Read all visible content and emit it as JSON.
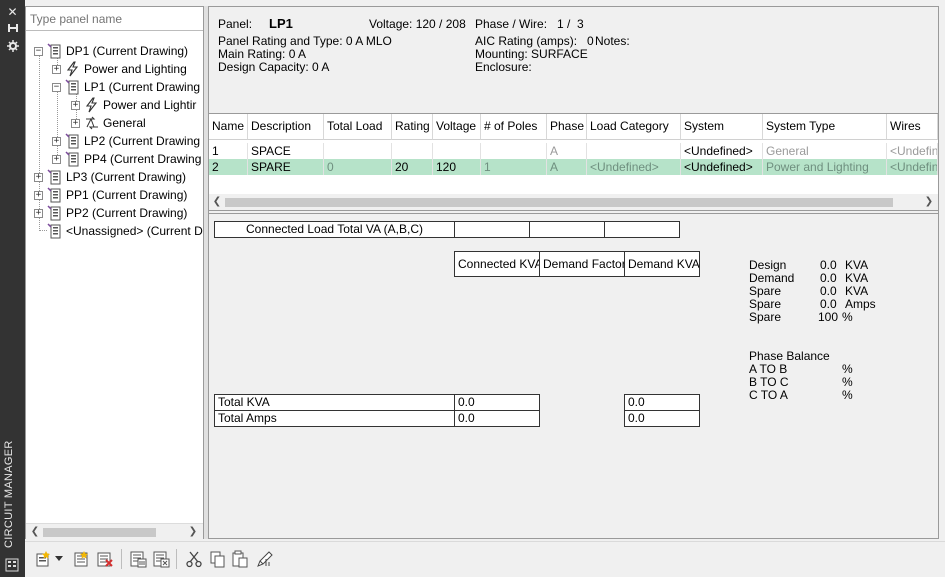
{
  "rail": {
    "title": "CIRCUIT MANAGER",
    "icons": [
      "close-icon",
      "auto-hide-icon",
      "properties-icon"
    ]
  },
  "tree": {
    "search_placeholder": "Type panel name",
    "nodes": [
      {
        "label": "DP1 (Current Drawing)",
        "icon": "panel-icon",
        "expander": "−"
      },
      {
        "label": "Power and Lighting",
        "icon": "lightning-icon",
        "expander": "+"
      },
      {
        "label": "LP1 (Current Drawing",
        "icon": "panel-icon",
        "expander": "−"
      },
      {
        "label": "Power and Lightir",
        "icon": "lightning-icon",
        "expander": "+"
      },
      {
        "label": "General",
        "icon": "circuit-icon",
        "expander": "+"
      },
      {
        "label": "LP2 (Current Drawing",
        "icon": "panel-icon",
        "expander": "+"
      },
      {
        "label": "PP4 (Current Drawing",
        "icon": "panel-icon",
        "expander": "+"
      },
      {
        "label": "LP3 (Current Drawing)",
        "icon": "panel-icon",
        "expander": "+"
      },
      {
        "label": "PP1 (Current Drawing)",
        "icon": "panel-icon",
        "expander": "+"
      },
      {
        "label": "PP2 (Current Drawing)",
        "icon": "panel-icon",
        "expander": "+"
      },
      {
        "label": "<Unassigned> (Current D",
        "icon": "panel-icon",
        "expander": ""
      }
    ]
  },
  "info": {
    "panel_label": "Panel:",
    "panel_value": "LP1",
    "voltage": "Voltage: 120 / 208",
    "phase_wire": "Phase / Wire:   1 /  3",
    "rating_type": "Panel Rating and Type: 0 A MLO",
    "aic": "AIC Rating (amps):   0",
    "notes": "Notes:",
    "main_rating": "Main Rating: 0 A",
    "mounting": "Mounting: SURFACE",
    "design_capacity": "Design Capacity: 0 A",
    "enclosure": "Enclosure:"
  },
  "grid": {
    "columns": [
      "Name",
      "Description",
      "Total Load",
      "Rating",
      "Voltage",
      "# of Poles",
      "Phase",
      "Load Category",
      "System",
      "System Type",
      "Wires"
    ],
    "rows": [
      {
        "cells": [
          "1",
          "SPACE",
          "",
          "",
          "",
          "",
          "A",
          "",
          "<Undefined>",
          "General",
          "<Undefin"
        ],
        "selected": false
      },
      {
        "cells": [
          "2",
          "SPARE",
          "0",
          "20",
          "120",
          "1",
          "A",
          "<Undefined>",
          "<Undefined>",
          "Power and Lighting",
          "<Undefin"
        ],
        "selected": true
      }
    ],
    "selected_color": "#b6e3c9"
  },
  "summary": {
    "connected_load_label": "Connected Load Total VA (A,B,C)",
    "headers": {
      "connected_kva": "Connected KVA",
      "demand_factor": "Demand Factor",
      "demand_kva": "Demand KVA"
    },
    "totals": [
      {
        "label": "Total KVA",
        "connected": "0.0",
        "demand": "0.0"
      },
      {
        "label": "Total Amps",
        "connected": "0.0",
        "demand": "0.0"
      }
    ],
    "stats": [
      {
        "label": "Design",
        "value": "0.0",
        "unit": "KVA"
      },
      {
        "label": "Demand",
        "value": "0.0",
        "unit": "KVA"
      },
      {
        "label": "Spare",
        "value": "0.0",
        "unit": "KVA"
      },
      {
        "label": "Spare",
        "value": "0.0",
        "unit": "Amps"
      },
      {
        "label": "Spare",
        "value": "100",
        "unit": "%"
      }
    ],
    "phase_balance": {
      "title": "Phase Balance",
      "rows": [
        {
          "label": "A TO B",
          "unit": "%"
        },
        {
          "label": "B TO C",
          "unit": "%"
        },
        {
          "label": "C TO A",
          "unit": "%"
        }
      ]
    }
  },
  "toolbar": {
    "buttons": [
      "new-panel-icon",
      "dropdown-arrow-icon",
      "add-circuit-icon",
      "delete-circuit-icon",
      "generate-schedule-icon",
      "update-schedule-icon",
      "cut-icon",
      "copy-icon",
      "paste-icon",
      "edit-circuit-icon"
    ]
  }
}
